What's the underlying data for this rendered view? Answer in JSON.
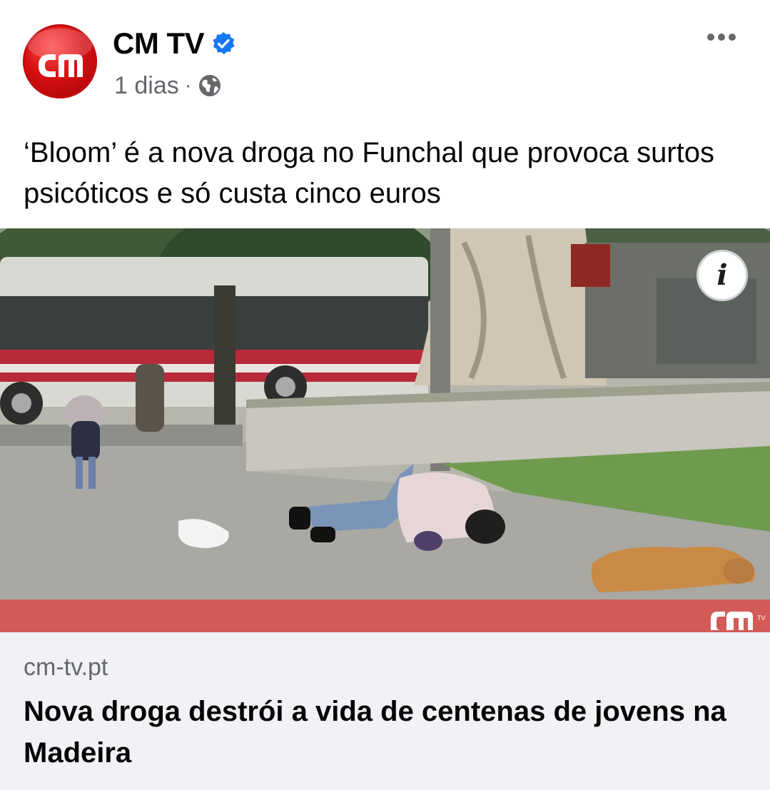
{
  "post": {
    "page_name": "CM TV",
    "verified_icon": "verified-badge-icon",
    "timestamp": "1 dias",
    "separator": "·",
    "audience_icon": "globe-icon",
    "more_icon": "more-options-icon",
    "avatar_logo_text": "cm",
    "text": "‘Bloom’ é a nova droga no Funchal que provoca surtos psicóticos e só custa cinco euros"
  },
  "media": {
    "info_icon": "info-icon",
    "info_label": "i",
    "watermark_text": "cm",
    "watermark_sup": "TV"
  },
  "link_preview": {
    "domain": "cm-tv.pt",
    "title": "Nova droga destrói a vida de centenas de jovens na Madeira"
  },
  "colors": {
    "brand_red": "#d60f12",
    "verified_blue": "#1877f2",
    "secondary_text": "#65676b",
    "link_box_bg": "#f0f2f5"
  }
}
